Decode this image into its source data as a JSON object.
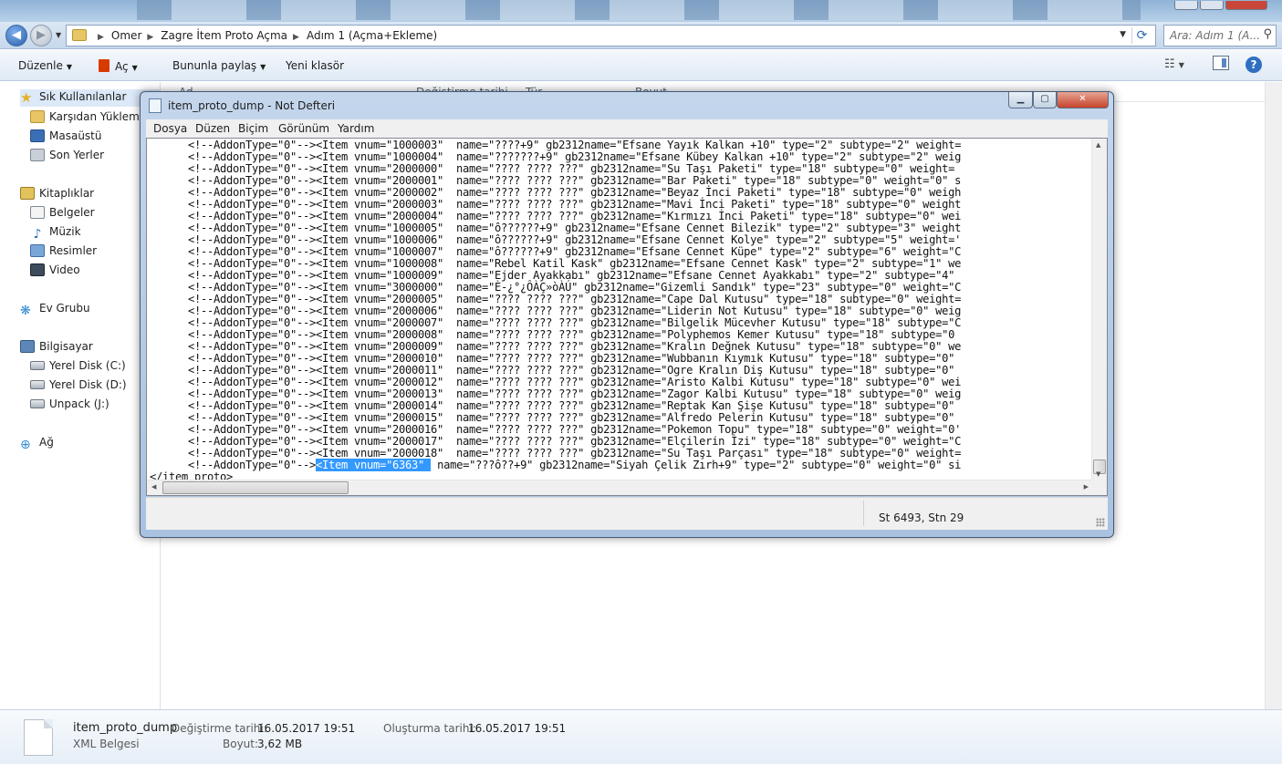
{
  "explorer": {
    "breadcrumb": [
      "Omer",
      "Zagre İtem Proto Açma",
      "Adım 1 (Açma+Ekleme)"
    ],
    "search_placeholder": "Ara: Adım 1 (A...",
    "toolbar": {
      "organize": "Düzenle",
      "open": "Aç",
      "share": "Bununla paylaş",
      "new_folder": "Yeni klasör"
    },
    "columns": [
      "Ad",
      "Değiştirme tarihi",
      "Tür",
      "Boyut"
    ],
    "nav": {
      "favorites": "Sık Kullanılanlar",
      "favorites_items": [
        "Karşıdan Yüklemeler",
        "Masaüstü",
        "Son Yerler"
      ],
      "libraries": "Kitaplıklar",
      "libraries_items": [
        "Belgeler",
        "Müzik",
        "Resimler",
        "Video"
      ],
      "homegroup": "Ev Grubu",
      "computer": "Bilgisayar",
      "computer_items": [
        "Yerel Disk (C:)",
        "Yerel Disk (D:)",
        "Unpack (J:)"
      ],
      "network": "Ağ"
    },
    "details": {
      "name": "item_proto_dump",
      "type": "XML Belgesi",
      "modified_label": "Değiştirme tarihi:",
      "modified_value": "16.05.2017 19:51",
      "size_label": "Boyut:",
      "size_value": "3,62 MB",
      "created_label": "Oluşturma tarihi:",
      "created_value": "16.05.2017 19:51"
    }
  },
  "notepad": {
    "title": "item_proto_dump - Not Defteri",
    "menu": [
      "Dosya",
      "Düzen",
      "Biçim",
      "Görünüm",
      "Yardım"
    ],
    "lines": [
      "      <!--AddonType=\"0\"--><Item vnum=\"1000003\"  name=\"????+9\" gb2312name=\"Efsane Yayık Kalkan +10\" type=\"2\" subtype=\"2\" weight=",
      "      <!--AddonType=\"0\"--><Item vnum=\"1000004\"  name=\"???????+9\" gb2312name=\"Efsane Kübey Kalkan +10\" type=\"2\" subtype=\"2\" weig",
      "      <!--AddonType=\"0\"--><Item vnum=\"2000000\"  name=\"???? ???? ???\" gb2312name=\"Su Taşı Paketi\" type=\"18\" subtype=\"0\" weight=",
      "      <!--AddonType=\"0\"--><Item vnum=\"2000001\"  name=\"???? ???? ???\" gb2312name=\"Bar Paketi\" type=\"18\" subtype=\"0\" weight=\"0\" s",
      "      <!--AddonType=\"0\"--><Item vnum=\"2000002\"  name=\"???? ???? ???\" gb2312name=\"Beyaz İnci Paketi\" type=\"18\" subtype=\"0\" weigh",
      "      <!--AddonType=\"0\"--><Item vnum=\"2000003\"  name=\"???? ???? ???\" gb2312name=\"Mavi İnci Paketi\" type=\"18\" subtype=\"0\" weight",
      "      <!--AddonType=\"0\"--><Item vnum=\"2000004\"  name=\"???? ???? ???\" gb2312name=\"Kırmızı İnci Paketi\" type=\"18\" subtype=\"0\" wei",
      "      <!--AddonType=\"0\"--><Item vnum=\"1000005\"  name=\"ô??????+9\" gb2312name=\"Efsane Cennet Bilezik\" type=\"2\" subtype=\"3\" weight",
      "      <!--AddonType=\"0\"--><Item vnum=\"1000006\"  name=\"ô??????+9\" gb2312name=\"Efsane Cennet Kolye\" type=\"2\" subtype=\"5\" weight='",
      "      <!--AddonType=\"0\"--><Item vnum=\"1000007\"  name=\"ô??????+9\" gb2312name=\"Efsane Cennet Küpe\" type=\"2\" subtype=\"6\" weight=\"C",
      "      <!--AddonType=\"0\"--><Item vnum=\"1000008\"  name=\"Rebel Katil Kask\" gb2312name=\"Efsane Cennet Kask\" type=\"2\" subtype=\"1\" we",
      "      <!--AddonType=\"0\"--><Item vnum=\"1000009\"  name=\"Ejder Ayakkabı\" gb2312name=\"Efsane Cennet Ayakkabı\" type=\"2\" subtype=\"4\" ",
      "      <!--AddonType=\"0\"--><Item vnum=\"3000000\"  name=\"È-¿°¿ÔÀÇ»òÀÚ\" gb2312name=\"Gizemli Sandık\" type=\"23\" subtype=\"0\" weight=\"C",
      "      <!--AddonType=\"0\"--><Item vnum=\"2000005\"  name=\"???? ???? ???\" gb2312name=\"Cape Dal Kutusu\" type=\"18\" subtype=\"0\" weight=",
      "      <!--AddonType=\"0\"--><Item vnum=\"2000006\"  name=\"???? ???? ???\" gb2312name=\"Liderin Not Kutusu\" type=\"18\" subtype=\"0\" weig",
      "      <!--AddonType=\"0\"--><Item vnum=\"2000007\"  name=\"???? ???? ???\" gb2312name=\"Bilgelik Mücevher Kutusu\" type=\"18\" subtype=\"C",
      "      <!--AddonType=\"0\"--><Item vnum=\"2000008\"  name=\"???? ???? ???\" gb2312name=\"Polyphemos Kemer Kutusu\" type=\"18\" subtype=\"0",
      "      <!--AddonType=\"0\"--><Item vnum=\"2000009\"  name=\"???? ???? ???\" gb2312name=\"Kralın Değnek Kutusu\" type=\"18\" subtype=\"0\" we",
      "      <!--AddonType=\"0\"--><Item vnum=\"2000010\"  name=\"???? ???? ???\" gb2312name=\"Wubbanın Kıymık Kutusu\" type=\"18\" subtype=\"0\" ",
      "      <!--AddonType=\"0\"--><Item vnum=\"2000011\"  name=\"???? ???? ???\" gb2312name=\"Ogre Kralın Diş Kutusu\" type=\"18\" subtype=\"0\" ",
      "      <!--AddonType=\"0\"--><Item vnum=\"2000012\"  name=\"???? ???? ???\" gb2312name=\"Aristo Kalbi Kutusu\" type=\"18\" subtype=\"0\" wei",
      "      <!--AddonType=\"0\"--><Item vnum=\"2000013\"  name=\"???? ???? ???\" gb2312name=\"Zagor Kalbi Kutusu\" type=\"18\" subtype=\"0\" weig",
      "      <!--AddonType=\"0\"--><Item vnum=\"2000014\"  name=\"???? ???? ???\" gb2312name=\"Reptak Kan Şişe Kutusu\" type=\"18\" subtype=\"0\" ",
      "      <!--AddonType=\"0\"--><Item vnum=\"2000015\"  name=\"???? ???? ???\" gb2312name=\"Alfredo Pelerin Kutusu\" type=\"18\" subtype=\"0\" ",
      "      <!--AddonType=\"0\"--><Item vnum=\"2000016\"  name=\"???? ???? ???\" gb2312name=\"Pokemon Topu\" type=\"18\" subtype=\"0\" weight=\"0'",
      "      <!--AddonType=\"0\"--><Item vnum=\"2000017\"  name=\"???? ???? ???\" gb2312name=\"Elçilerin İzi\" type=\"18\" subtype=\"0\" weight=\"C",
      "      <!--AddonType=\"0\"--><Item vnum=\"2000018\"  name=\"???? ???? ???\" gb2312name=\"Su Taşı Parçası\" type=\"18\" subtype=\"0\" weight="
    ],
    "last_line_prefix": "      <!--AddonType=\"0\"-->",
    "last_line_selected": "<Item vnum=\"6363\" ",
    "last_line_suffix": " name=\"???ô??+9\" gb2312name=\"Siyah Çelik Zırh+9\" type=\"2\" subtype=\"0\" weight=\"0\" si",
    "closing_line": "</item_proto>",
    "status": "St 6493, Stn 29"
  },
  "colors": {
    "selection": "#3399ff",
    "frame_title": "#b9d1ea",
    "close_button": "#c6442c"
  }
}
